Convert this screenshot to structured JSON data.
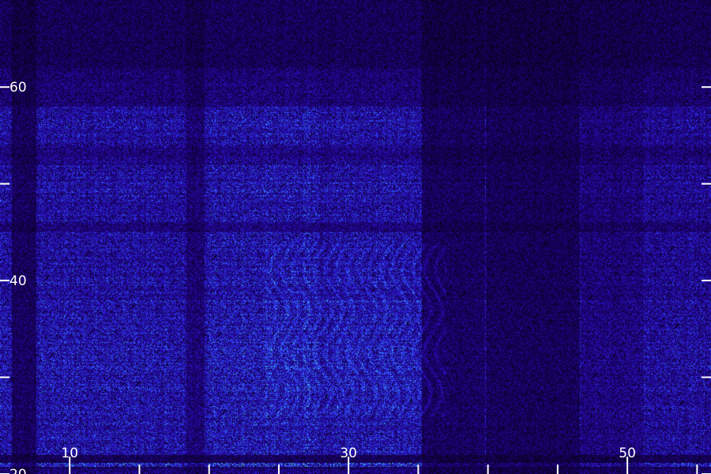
{
  "chart_data": {
    "type": "heatmap",
    "title": "",
    "xlabel": "",
    "ylabel": "",
    "xlim": [
      5,
      56
    ],
    "ylim": [
      20,
      69
    ],
    "x_major_ticks": [
      10,
      30,
      50
    ],
    "x_ticks": [
      10,
      15,
      20,
      25,
      30,
      35,
      40,
      45,
      50,
      55
    ],
    "y_major_ticks": [
      60,
      40,
      20
    ],
    "y_ticks": [
      60,
      50,
      40,
      30,
      20
    ],
    "grid": false,
    "colormap": [
      "#000000",
      "#1a0066",
      "#2a10c8",
      "#2f5bff",
      "#3fb8ff",
      "#7dff6a"
    ],
    "background": "#000000",
    "tick_color": "#ffffff"
  }
}
